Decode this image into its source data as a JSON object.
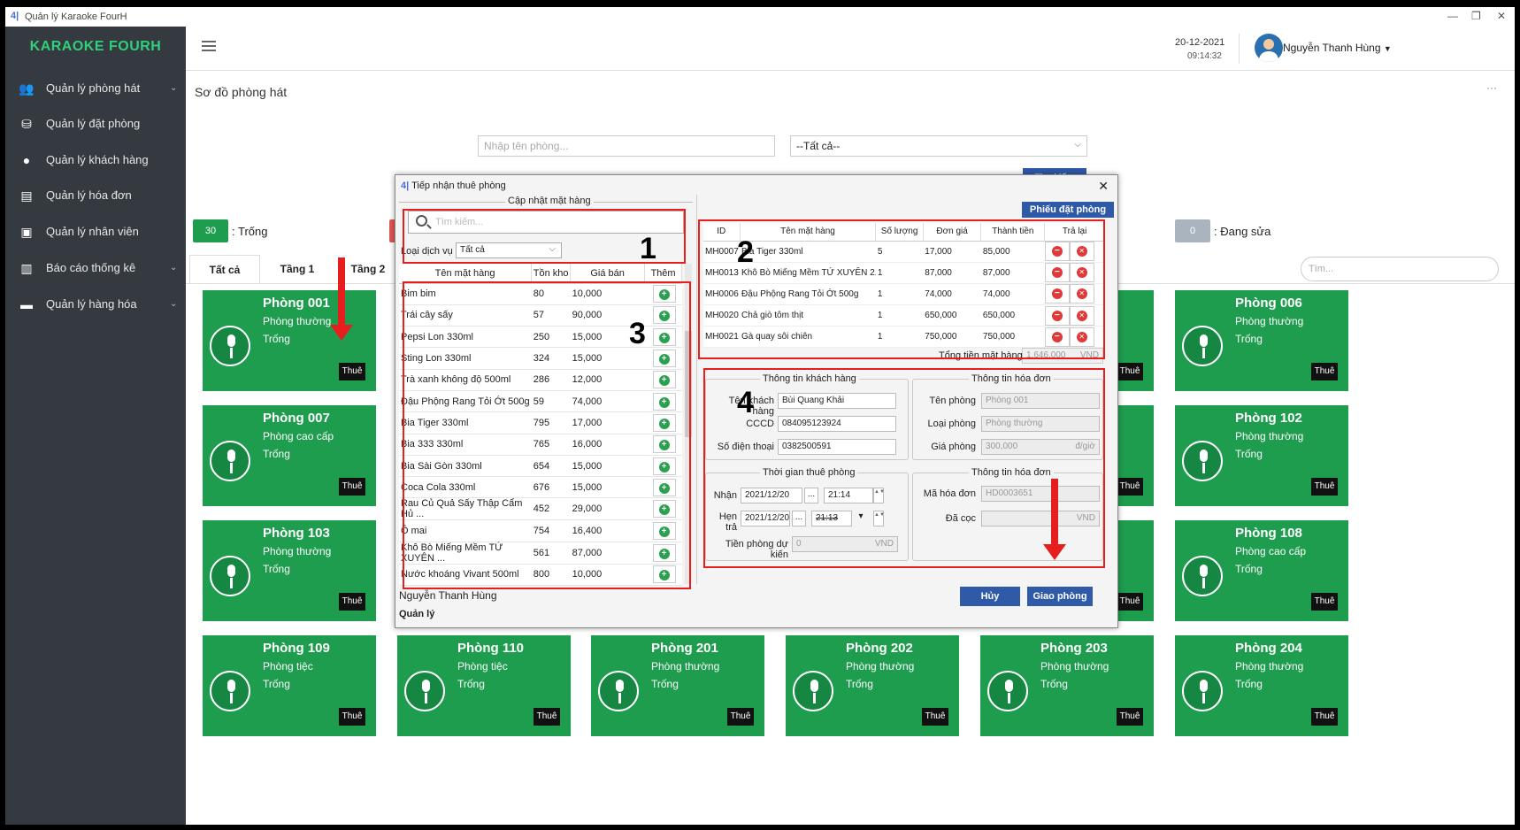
{
  "window": {
    "title": "Quản lý Karaoke FourH",
    "logo": "4|",
    "controls": [
      "—",
      "❐",
      "✕"
    ]
  },
  "brand": "KARAOKE FOURH",
  "sidebar": [
    {
      "label": "Quản lý phòng hát",
      "icon": "people-icon",
      "chev": "⌄"
    },
    {
      "label": "Quản lý đặt phòng",
      "icon": "booking-icon",
      "chev": ""
    },
    {
      "label": "Quản lý khách hàng",
      "icon": "user-icon",
      "chev": ""
    },
    {
      "label": "Quản lý hóa đơn",
      "icon": "invoice-icon",
      "chev": ""
    },
    {
      "label": "Quản lý nhân viên",
      "icon": "badge-icon",
      "chev": ""
    },
    {
      "label": "Báo cáo thống kê",
      "icon": "chart-icon",
      "chev": "⌄"
    },
    {
      "label": "Quản lý hàng hóa",
      "icon": "box-icon",
      "chev": "⌄"
    }
  ],
  "topbar": {
    "date": "20-12-2021",
    "time": "09:14:32",
    "user": "Nguyễn Thanh Hùng",
    "caret": "▼"
  },
  "page": {
    "title": "Sơ đồ phòng hát",
    "dots": "···",
    "search_placeholder": "Nhập tên phòng...",
    "filter": "--Tất cả--",
    "find": "Tìm kiếm",
    "tab_search_placeholder": "Tìm..."
  },
  "stats": {
    "empty_count": "30",
    "empty_label": ": Trống",
    "repair_count": "0",
    "repair_label": ": Đang sửa"
  },
  "tabs": [
    "Tất cả",
    "Tầng 1",
    "Tầng 2"
  ],
  "rooms": [
    {
      "name": "Phòng 001",
      "type": "Phòng thường",
      "status": "Trống",
      "btn": "Thuê"
    },
    {
      "name": "Phòng 006",
      "type": "Phòng thường",
      "status": "Trống",
      "btn": "Thuê"
    },
    {
      "name": "Phòng 007",
      "type": "Phòng cao cấp",
      "status": "Trống",
      "btn": "Thuê"
    },
    {
      "name": "Phòng 102",
      "type": "Phòng thường",
      "status": "Trống",
      "btn": "Thuê"
    },
    {
      "name": "Phòng 103",
      "type": "Phòng thường",
      "status": "Trống",
      "btn": "Thuê"
    },
    {
      "name": "Phòng 108",
      "type": "Phòng cao cấp",
      "status": "Trống",
      "btn": "Thuê"
    },
    {
      "name": "Phòng 109",
      "type": "Phòng tiệc",
      "status": "Trống",
      "btn": "Thuê"
    },
    {
      "name": "Phòng 110",
      "type": "Phòng tiệc",
      "status": "Trống",
      "btn": "Thuê"
    },
    {
      "name": "Phòng 201",
      "type": "Phòng thường",
      "status": "Trống",
      "btn": "Thuê"
    },
    {
      "name": "Phòng 202",
      "type": "Phòng thường",
      "status": "Trống",
      "btn": "Thuê"
    },
    {
      "name": "Phòng 203",
      "type": "Phòng thường",
      "status": "Trống",
      "btn": "Thuê"
    },
    {
      "name": "Phòng 204",
      "type": "Phòng thường",
      "status": "Trống",
      "btn": "Thuê"
    }
  ],
  "dialog": {
    "title": "Tiếp nhận thuê phòng",
    "close": "✕",
    "update_group": "Cập nhật mặt hàng",
    "search_placeholder": "Tìm kiếm...",
    "service_type_label": "Loại dịch vụ",
    "service_type": "Tất cả",
    "goods_headers": [
      "Tên mặt hàng",
      "Tồn kho",
      "Giá bán",
      "Thêm"
    ],
    "goods": [
      [
        "Bim bim",
        "80",
        "10,000"
      ],
      [
        "Trái cây sấy",
        "57",
        "90,000"
      ],
      [
        "Pepsi Lon 330ml",
        "250",
        "15,000"
      ],
      [
        "Sting Lon 330ml",
        "324",
        "15,000"
      ],
      [
        "Trà xanh không độ 500ml",
        "286",
        "12,000"
      ],
      [
        "Đậu Phộng Rang Tỏi Ớt 500g",
        "59",
        "74,000"
      ],
      [
        "Bia Tiger 330ml",
        "795",
        "17,000"
      ],
      [
        "Bia 333 330ml",
        "765",
        "16,000"
      ],
      [
        "Bia Sài Gòn 330ml",
        "654",
        "15,000"
      ],
      [
        "Coca Cola 330ml",
        "676",
        "15,000"
      ],
      [
        "Rau Củ Quả Sấy Thập Cẩm Hủ ...",
        "452",
        "29,000"
      ],
      [
        "Ô mai",
        "754",
        "16,400"
      ],
      [
        "Khô Bò Miếng Mềm TỨ XUYÊN ...",
        "561",
        "87,000"
      ],
      [
        "Nước khoáng Vivant 500ml",
        "800",
        "10,000"
      ]
    ],
    "booking_btn": "Phiếu đặt phòng",
    "order_headers": [
      "ID",
      "Tên mặt hàng",
      "Số lượng",
      "Đơn giá",
      "Thành tiền",
      "Trả lại"
    ],
    "orders": [
      [
        "MH0007",
        "Bia Tiger 330ml",
        "5",
        "17,000",
        "85,000"
      ],
      [
        "MH0013",
        "Khô Bò Miếng Mềm TỨ XUYÊN 2...",
        "1",
        "87,000",
        "87,000"
      ],
      [
        "MH0006",
        "Đậu Phộng Rang Tỏi Ớt 500g",
        "1",
        "74,000",
        "74,000"
      ],
      [
        "MH0020",
        "Chả giò tôm thịt",
        "1",
        "650,000",
        "650,000"
      ],
      [
        "MH0021",
        "Gà quay sôi chiên",
        "1",
        "750,000",
        "750,000"
      ]
    ],
    "total_label": "Tổng tiền mặt hàng",
    "total": "1,646,000",
    "currency": "VND",
    "customer": {
      "group": "Thông tin khách hàng",
      "name_label": "Tên khách hàng",
      "name": "Bùi Quang Khải",
      "cccd_label": "CCCD",
      "cccd": "084095123924",
      "phone_label": "Số điện thoại",
      "phone": "0382500591"
    },
    "invoice1": {
      "group": "Thông tin hóa đơn",
      "room_label": "Tên phòng",
      "room": "Phòng 001",
      "type_label": "Loại phòng",
      "type": "Phòng thường",
      "price_label": "Giá phòng",
      "price": "300,000",
      "unit": "đ/giờ"
    },
    "time": {
      "group": "Thời gian thuê phòng",
      "recv_label": "Nhận",
      "recv_date": "2021/12/20",
      "recv_time": "21:14",
      "ret_label": "Hẹn trả",
      "ret_date": "2021/12/20",
      "ret_time": "21:13",
      "est_label": "Tiền phòng dự kiến",
      "est": "0",
      "currency": "VND",
      "dots": "...",
      "spin": "▲▼",
      "drop": "▾"
    },
    "invoice2": {
      "group": "Thông tin hóa đơn",
      "code_label": "Mã hóa đơn",
      "code": "HD0003651",
      "deposit_label": "Đã cọc",
      "currency": "VND"
    },
    "employee": "Nguyễn Thanh Hùng",
    "role": "Quản lý",
    "cancel": "Hủy",
    "deliver": "Giao phòng"
  },
  "annotations": [
    "1",
    "2",
    "3",
    "4"
  ],
  "colors": {
    "sidebar": "#343a40",
    "brand": "#2fd07a",
    "room": "#1f9d4f",
    "button": "#2e5aa8",
    "annotation": "#e61e1e"
  }
}
